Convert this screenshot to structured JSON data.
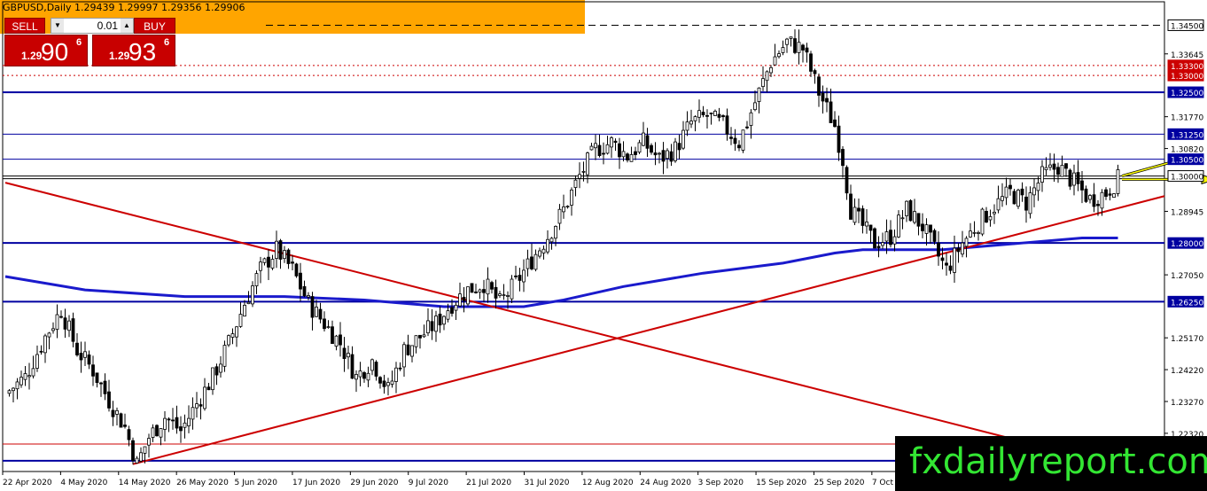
{
  "header": {
    "title": "GBPUSD,Daily  1.29439 1.29997 1.29356 1.29906"
  },
  "trade_panel": {
    "sell_label": "SELL",
    "buy_label": "BUY",
    "lot_value": "0.01",
    "sell_price": {
      "prefix": "1.29",
      "big": "90",
      "sup": "6"
    },
    "buy_price": {
      "prefix": "1.29",
      "big": "93",
      "sup": "6"
    }
  },
  "watermark": "fxdailyreport.com",
  "colors": {
    "candle_up": "#ffffff",
    "candle_down": "#000000",
    "level_line": "#0000a0",
    "moving_average": "#1a1acc",
    "trendline": "#cc0000",
    "arrow": "#ffff00",
    "orange_header": "#ffa500",
    "watermark_text": "#33e633"
  },
  "chart_data": {
    "type": "candlestick",
    "symbol": "GBPUSD",
    "timeframe": "Daily",
    "y_range": [
      1.2118,
      1.352
    ],
    "x_ticks": [
      "22 Apr 2020",
      "4 May 2020",
      "14 May 2020",
      "26 May 2020",
      "5 Jun 2020",
      "17 Jun 2020",
      "29 Jun 2020",
      "9 Jul 2020",
      "21 Jul 2020",
      "31 Jul 2020",
      "12 Aug 2020",
      "24 Aug 2020",
      "3 Sep 2020",
      "15 Sep 2020",
      "25 Sep 2020",
      "7 Oct 2020"
    ],
    "y_ticks": [
      "1.33645",
      "1.31770",
      "1.30820",
      "1.28945",
      "1.27050",
      "1.25170",
      "1.24220",
      "1.23270",
      "1.22320"
    ],
    "price_labels": [
      {
        "value": 1.345,
        "text": "1.34500",
        "style": "dashed",
        "color": "#000000"
      },
      {
        "value": 1.333,
        "text": "1.33300",
        "style": "dotted",
        "color": "#cc0000"
      },
      {
        "value": 1.33,
        "text": "1.33000",
        "style": "dotted",
        "color": "#cc0000"
      },
      {
        "value": 1.325,
        "text": "1.32500",
        "style": "solid-thick",
        "color": "#0000a0"
      },
      {
        "value": 1.3125,
        "text": "1.31250",
        "style": "solid",
        "color": "#0000a0"
      },
      {
        "value": 1.305,
        "text": "1.30500",
        "style": "solid",
        "color": "#0000a0"
      },
      {
        "value": 1.3,
        "text": "1.30000",
        "style": "solid-double",
        "color": "#000000"
      },
      {
        "value": 1.28,
        "text": "1.28000",
        "style": "solid-thick",
        "color": "#0000a0"
      },
      {
        "value": 1.2625,
        "text": "1.26250",
        "style": "solid-thick",
        "color": "#0000a0"
      },
      {
        "value": 1.22,
        "text": "1.22000",
        "style": "solid",
        "color": "#cc0000"
      },
      {
        "value": 1.215,
        "text": "",
        "style": "solid-thick",
        "color": "#0000a0"
      }
    ],
    "close_path": [
      [
        0,
        1.235
      ],
      [
        5,
        1.24
      ],
      [
        10,
        1.252
      ],
      [
        14,
        1.26
      ],
      [
        18,
        1.248
      ],
      [
        22,
        1.242
      ],
      [
        26,
        1.233
      ],
      [
        30,
        1.225
      ],
      [
        33,
        1.214
      ],
      [
        36,
        1.222
      ],
      [
        40,
        1.228
      ],
      [
        44,
        1.224
      ],
      [
        48,
        1.232
      ],
      [
        52,
        1.24
      ],
      [
        56,
        1.25
      ],
      [
        60,
        1.262
      ],
      [
        64,
        1.272
      ],
      [
        68,
        1.278
      ],
      [
        72,
        1.272
      ],
      [
        76,
        1.262
      ],
      [
        80,
        1.256
      ],
      [
        84,
        1.25
      ],
      [
        88,
        1.24
      ],
      [
        92,
        1.245
      ],
      [
        96,
        1.236
      ],
      [
        100,
        1.248
      ],
      [
        104,
        1.252
      ],
      [
        108,
        1.256
      ],
      [
        112,
        1.262
      ],
      [
        116,
        1.266
      ],
      [
        120,
        1.268
      ],
      [
        124,
        1.262
      ],
      [
        128,
        1.268
      ],
      [
        132,
        1.275
      ],
      [
        136,
        1.282
      ],
      [
        140,
        1.29
      ],
      [
        144,
        1.3
      ],
      [
        148,
        1.308
      ],
      [
        152,
        1.31
      ],
      [
        156,
        1.306
      ],
      [
        160,
        1.31
      ],
      [
        164,
        1.305
      ],
      [
        168,
        1.308
      ],
      [
        172,
        1.316
      ],
      [
        176,
        1.318
      ],
      [
        180,
        1.315
      ],
      [
        184,
        1.31
      ],
      [
        188,
        1.322
      ],
      [
        192,
        1.334
      ],
      [
        196,
        1.34
      ],
      [
        200,
        1.338
      ],
      [
        204,
        1.325
      ],
      [
        208,
        1.315
      ],
      [
        210,
        1.305
      ],
      [
        212,
        1.29
      ],
      [
        215,
        1.285
      ],
      [
        218,
        1.28
      ],
      [
        222,
        1.282
      ],
      [
        226,
        1.29
      ],
      [
        230,
        1.285
      ],
      [
        233,
        1.278
      ],
      [
        236,
        1.272
      ],
      [
        240,
        1.28
      ],
      [
        244,
        1.286
      ],
      [
        248,
        1.291
      ],
      [
        252,
        1.295
      ],
      [
        256,
        1.292
      ],
      [
        260,
        1.3
      ],
      [
        264,
        1.303
      ],
      [
        268,
        1.298
      ],
      [
        272,
        1.293
      ],
      [
        276,
        1.295
      ],
      [
        279,
        1.299
      ]
    ],
    "moving_average": [
      [
        0,
        1.27
      ],
      [
        20,
        1.266
      ],
      [
        45,
        1.264
      ],
      [
        70,
        1.264
      ],
      [
        90,
        1.263
      ],
      [
        110,
        1.261
      ],
      [
        130,
        1.261
      ],
      [
        140,
        1.263
      ],
      [
        155,
        1.267
      ],
      [
        175,
        1.271
      ],
      [
        195,
        1.274
      ],
      [
        208,
        1.277
      ],
      [
        215,
        1.278
      ],
      [
        235,
        1.278
      ],
      [
        255,
        1.28
      ],
      [
        270,
        1.2815
      ],
      [
        279,
        1.2815
      ]
    ],
    "trendlines": [
      {
        "name": "descending",
        "from": [
          0,
          1.298
        ],
        "to": [
          335,
          1.21
        ]
      },
      {
        "name": "ascending",
        "from": [
          32,
          1.214
        ],
        "to": [
          335,
          1.294
        ]
      }
    ],
    "arrows": [
      {
        "direction": "up",
        "from": [
          280,
          1.3
        ],
        "to": [
          295,
          1.305
        ]
      },
      {
        "direction": "right",
        "from": [
          280,
          1.299
        ],
        "to": [
          300,
          1.299
        ]
      }
    ]
  }
}
